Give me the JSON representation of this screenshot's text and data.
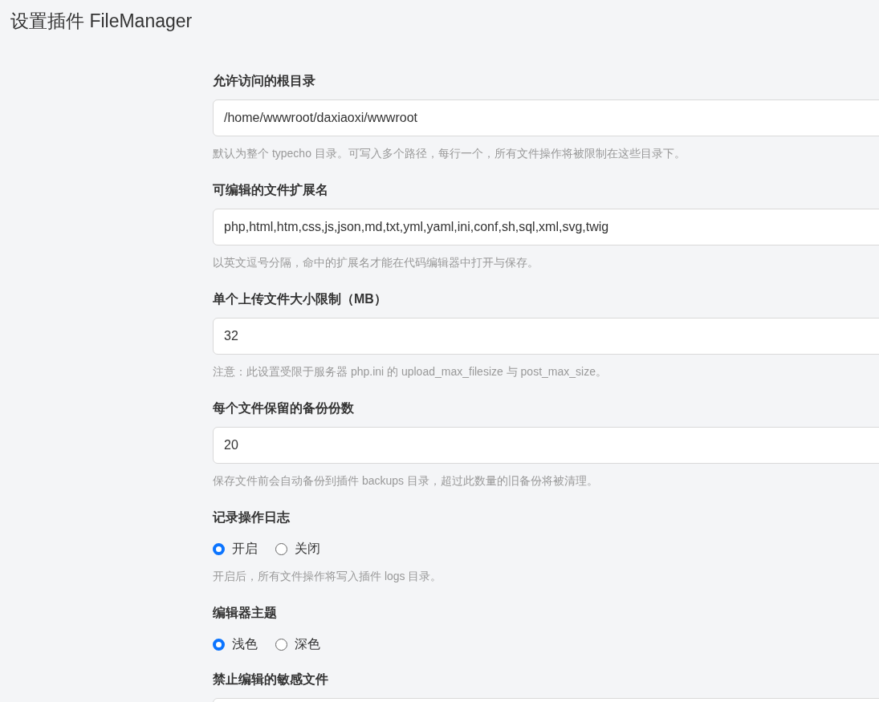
{
  "title": "设置插件 FileManager",
  "fields": [
    {
      "kind": "text",
      "label": "允许访问的根目录",
      "value": "/home/wwwroot/daxiaoxi/wwwroot",
      "help": "默认为整个 typecho 目录。可写入多个路径，每行一个，所有文件操作将被限制在这些目录下。"
    },
    {
      "kind": "text",
      "label": "可编辑的文件扩展名",
      "value": "php,html,htm,css,js,json,md,txt,yml,yaml,ini,conf,sh,sql,xml,svg,twig",
      "help": "以英文逗号分隔，命中的扩展名才能在代码编辑器中打开与保存。"
    },
    {
      "kind": "text",
      "label": "单个上传文件大小限制（MB）",
      "value": "32",
      "help": "注意：此设置受限于服务器 php.ini 的 upload_max_filesize 与 post_max_size。"
    },
    {
      "kind": "text",
      "label": "每个文件保留的备份份数",
      "value": "20",
      "help": "保存文件前会自动备份到插件 backups 目录，超过此数量的旧备份将被清理。"
    },
    {
      "kind": "radio",
      "label": "记录操作日志",
      "options": [
        {
          "label": "开启",
          "selected": true
        },
        {
          "label": "关闭",
          "selected": false
        }
      ],
      "help": "开启后，所有文件操作将写入插件 logs 目录。"
    },
    {
      "kind": "radio",
      "label": "编辑器主题",
      "options": [
        {
          "label": "浅色",
          "selected": true
        },
        {
          "label": "深色",
          "selected": false
        }
      ]
    },
    {
      "kind": "textarea",
      "label": "禁止编辑的敏感文件"
    }
  ]
}
